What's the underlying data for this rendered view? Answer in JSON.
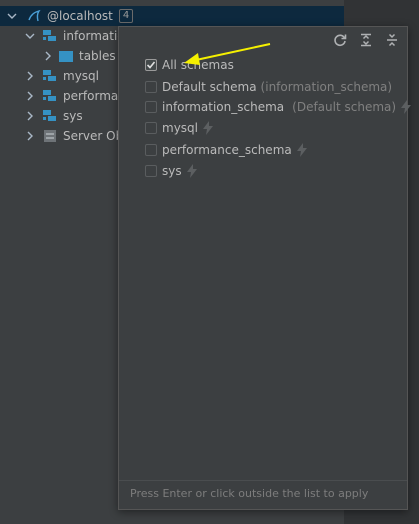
{
  "tree": {
    "root": {
      "label": "@localhost",
      "badge": "4"
    },
    "items": [
      {
        "label": "information_schema"
      },
      {
        "label": "tables"
      },
      {
        "label": "mysql"
      },
      {
        "label": "performance_schema"
      },
      {
        "label": "sys"
      },
      {
        "label": "Server Objects"
      }
    ]
  },
  "popup": {
    "all_schemas_label": "All schemas",
    "all_schemas_checked": true,
    "options": [
      {
        "label": "Default schema",
        "hint": "(information_schema)",
        "bolt": false
      },
      {
        "label": "information_schema",
        "hint": "(Default schema)",
        "bolt": true
      },
      {
        "label": "mysql",
        "hint": "",
        "bolt": true
      },
      {
        "label": "performance_schema",
        "hint": "",
        "bolt": true
      },
      {
        "label": "sys",
        "hint": "",
        "bolt": true
      }
    ],
    "footer": "Press Enter or click outside the list to apply"
  },
  "colors": {
    "annotation_arrow": "#f5f000",
    "schema_icon": "#3592c4",
    "selection": "#0d293e"
  },
  "icons": [
    "refresh-icon",
    "expand-all-icon",
    "collapse-all-icon",
    "bolt-icon",
    "database-icon",
    "folder-icon"
  ]
}
